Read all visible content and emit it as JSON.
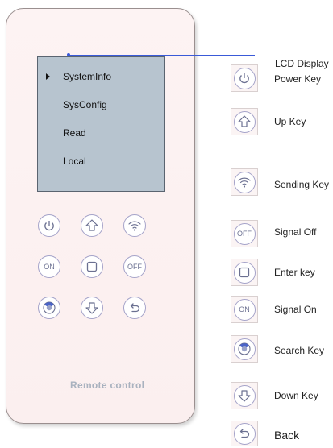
{
  "lcd": {
    "menu": [
      "SystemInfo",
      "SysConfig",
      "Read",
      "Local"
    ],
    "selected_index": 0
  },
  "remote": {
    "brand": "Remote control",
    "on_label": "ON",
    "off_label": "OFF"
  },
  "callout": {
    "lcd_label": "LCD Display"
  },
  "legend": [
    {
      "icon": "power-icon",
      "label": "Power Key"
    },
    {
      "icon": "up-arrow-icon",
      "label": "Up Key"
    },
    {
      "icon": "wifi-icon",
      "label": "Sending Key"
    },
    {
      "icon": "off-icon",
      "label": "Signal Off"
    },
    {
      "icon": "square-icon",
      "label": "Enter key"
    },
    {
      "icon": "on-icon",
      "label": "Signal On"
    },
    {
      "icon": "radar-icon",
      "label": "Search Key"
    },
    {
      "icon": "down-arrow-icon",
      "label": "Down Key"
    },
    {
      "icon": "back-icon",
      "label": "Back"
    }
  ],
  "colors": {
    "lcd": "#b7c4cf",
    "button_border": "#a5a3c9",
    "leader_line": "#3a5ad8"
  }
}
